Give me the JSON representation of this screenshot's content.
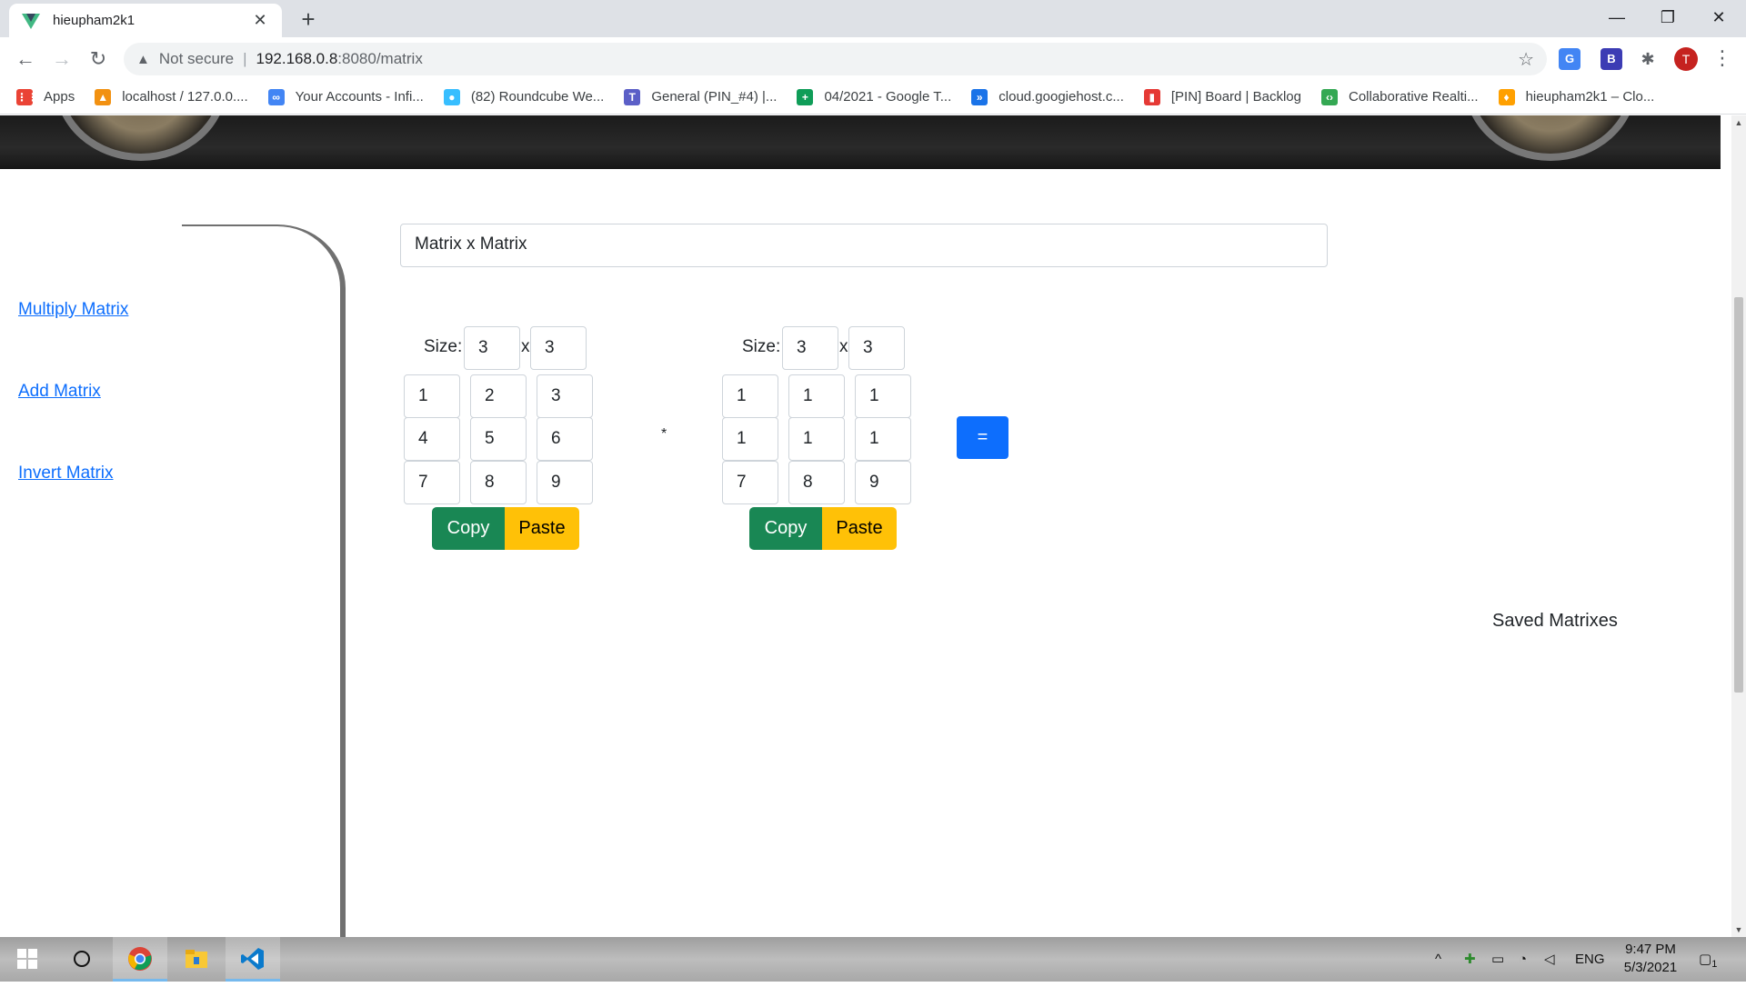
{
  "browser": {
    "tab_title": "hieupham2k1",
    "tab_close": "✕",
    "new_tab": "+",
    "win_minimize": "—",
    "win_restore": "❐",
    "win_close": "✕",
    "address": {
      "warning": "Not secure",
      "separator": "|",
      "host": "192.168.0.8",
      "path": ":8080/matrix"
    },
    "avatar_letter": "T",
    "extensions": [
      "G",
      "B",
      "✱"
    ],
    "bookmarks": [
      {
        "label": "Apps",
        "icon": "apps-grid-icon",
        "color": "#ea4335",
        "glyph": "⋮⋮"
      },
      {
        "label": "localhost / 127.0.0....",
        "icon": "phpmyadmin-icon",
        "color": "#f29111",
        "glyph": "▲"
      },
      {
        "label": "Your Accounts - Infi...",
        "icon": "infinity-icon",
        "color": "#4285f4",
        "glyph": "∞"
      },
      {
        "label": "(82) Roundcube We...",
        "icon": "roundcube-icon",
        "color": "#37beff",
        "glyph": "●"
      },
      {
        "label": "General (PIN_#4) |...",
        "icon": "teams-icon",
        "color": "#5b5fc7",
        "glyph": "T"
      },
      {
        "label": "04/2021 - Google T...",
        "icon": "sheets-icon",
        "color": "#0f9d58",
        "glyph": "+"
      },
      {
        "label": "cloud.googiehost.c...",
        "icon": "googiehost-icon",
        "color": "#1a73e8",
        "glyph": "»"
      },
      {
        "label": "[PIN] Board | Backlog",
        "icon": "backlog-icon",
        "color": "#e53935",
        "glyph": "▮"
      },
      {
        "label": "Collaborative Realti...",
        "icon": "code-icon",
        "color": "#34a853",
        "glyph": "‹›"
      },
      {
        "label": "hieupham2k1 – Clo...",
        "icon": "firebase-icon",
        "color": "#ffa000",
        "glyph": "♦"
      }
    ]
  },
  "sidebar": {
    "links": [
      "Multiply Matrix",
      "Add Matrix",
      "Invert Matrix"
    ]
  },
  "main": {
    "operation": "Matrix x Matrix",
    "size_label": "Size:",
    "x_label": "x",
    "operator": "*",
    "equals_label": "=",
    "copy_label": "Copy",
    "paste_label": "Paste",
    "saved_label": "Saved Matrixes",
    "matrix_a": {
      "rows": "3",
      "cols": "3",
      "cells": [
        [
          "1",
          "2",
          "3"
        ],
        [
          "4",
          "5",
          "6"
        ],
        [
          "7",
          "8",
          "9"
        ]
      ]
    },
    "matrix_b": {
      "rows": "3",
      "cols": "3",
      "cells": [
        [
          "1",
          "1",
          "1"
        ],
        [
          "1",
          "1",
          "1"
        ],
        [
          "7",
          "8",
          "9"
        ]
      ]
    }
  },
  "taskbar": {
    "language": "ENG",
    "time": "9:47 PM",
    "date": "5/3/2021",
    "notification_count": "1"
  },
  "colors": {
    "copy": "#198754",
    "paste": "#ffc107",
    "equals": "#0d6efd",
    "link": "#0d6efd"
  }
}
